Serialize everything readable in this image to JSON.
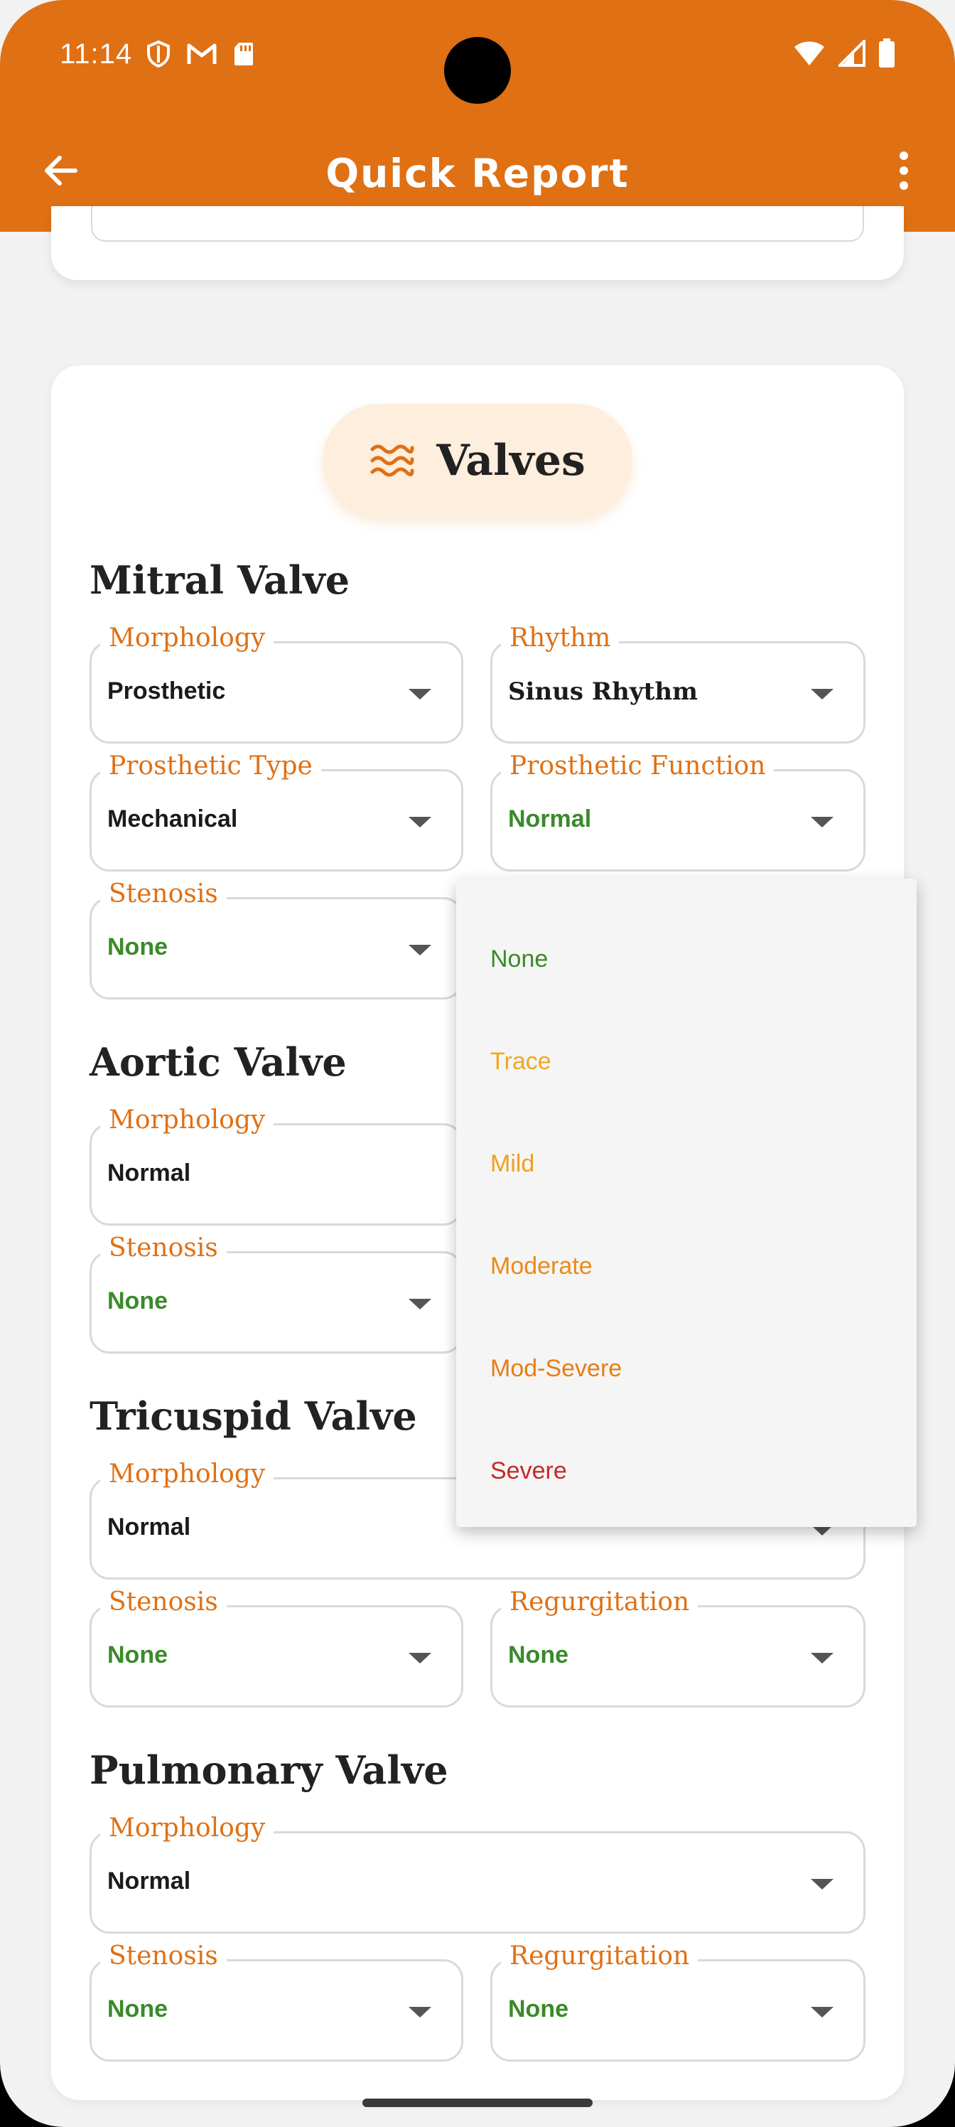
{
  "status": {
    "time": "11:14"
  },
  "header": {
    "title": "Quick Report"
  },
  "section": {
    "title": "Valves"
  },
  "mitral": {
    "title": "Mitral Valve",
    "morphology": {
      "label": "Morphology",
      "value": "Prosthetic"
    },
    "rhythm": {
      "label": "Rhythm",
      "value": "Sinus Rhythm"
    },
    "prosthetic_type": {
      "label": "Prosthetic Type",
      "value": "Mechanical"
    },
    "prosthetic_function": {
      "label": "Prosthetic Function",
      "value": "Normal"
    },
    "stenosis": {
      "label": "Stenosis",
      "value": "None"
    }
  },
  "aortic": {
    "title": "Aortic Valve",
    "morphology": {
      "label": "Morphology",
      "value": "Normal"
    },
    "stenosis": {
      "label": "Stenosis",
      "value": "None"
    }
  },
  "tricuspid": {
    "title": "Tricuspid Valve",
    "morphology": {
      "label": "Morphology",
      "value": "Normal"
    },
    "stenosis": {
      "label": "Stenosis",
      "value": "None"
    },
    "regurgitation": {
      "label": "Regurgitation",
      "value": "None"
    }
  },
  "pulmonary": {
    "title": "Pulmonary Valve",
    "morphology": {
      "label": "Morphology",
      "value": "Normal"
    },
    "stenosis": {
      "label": "Stenosis",
      "value": "None"
    },
    "regurgitation": {
      "label": "Regurgitation",
      "value": "None"
    }
  },
  "dropdown": {
    "options": [
      {
        "label": "None",
        "color": "#3a8a2a"
      },
      {
        "label": "Trace",
        "color": "#f0a820"
      },
      {
        "label": "Mild",
        "color": "#f0a020"
      },
      {
        "label": "Moderate",
        "color": "#ea8a18"
      },
      {
        "label": "Mod-Severe",
        "color": "#e87d14"
      },
      {
        "label": "Severe",
        "color": "#c62828"
      }
    ]
  },
  "colors": {
    "accent": "#e07014",
    "value_green": "#3a8a2a"
  }
}
